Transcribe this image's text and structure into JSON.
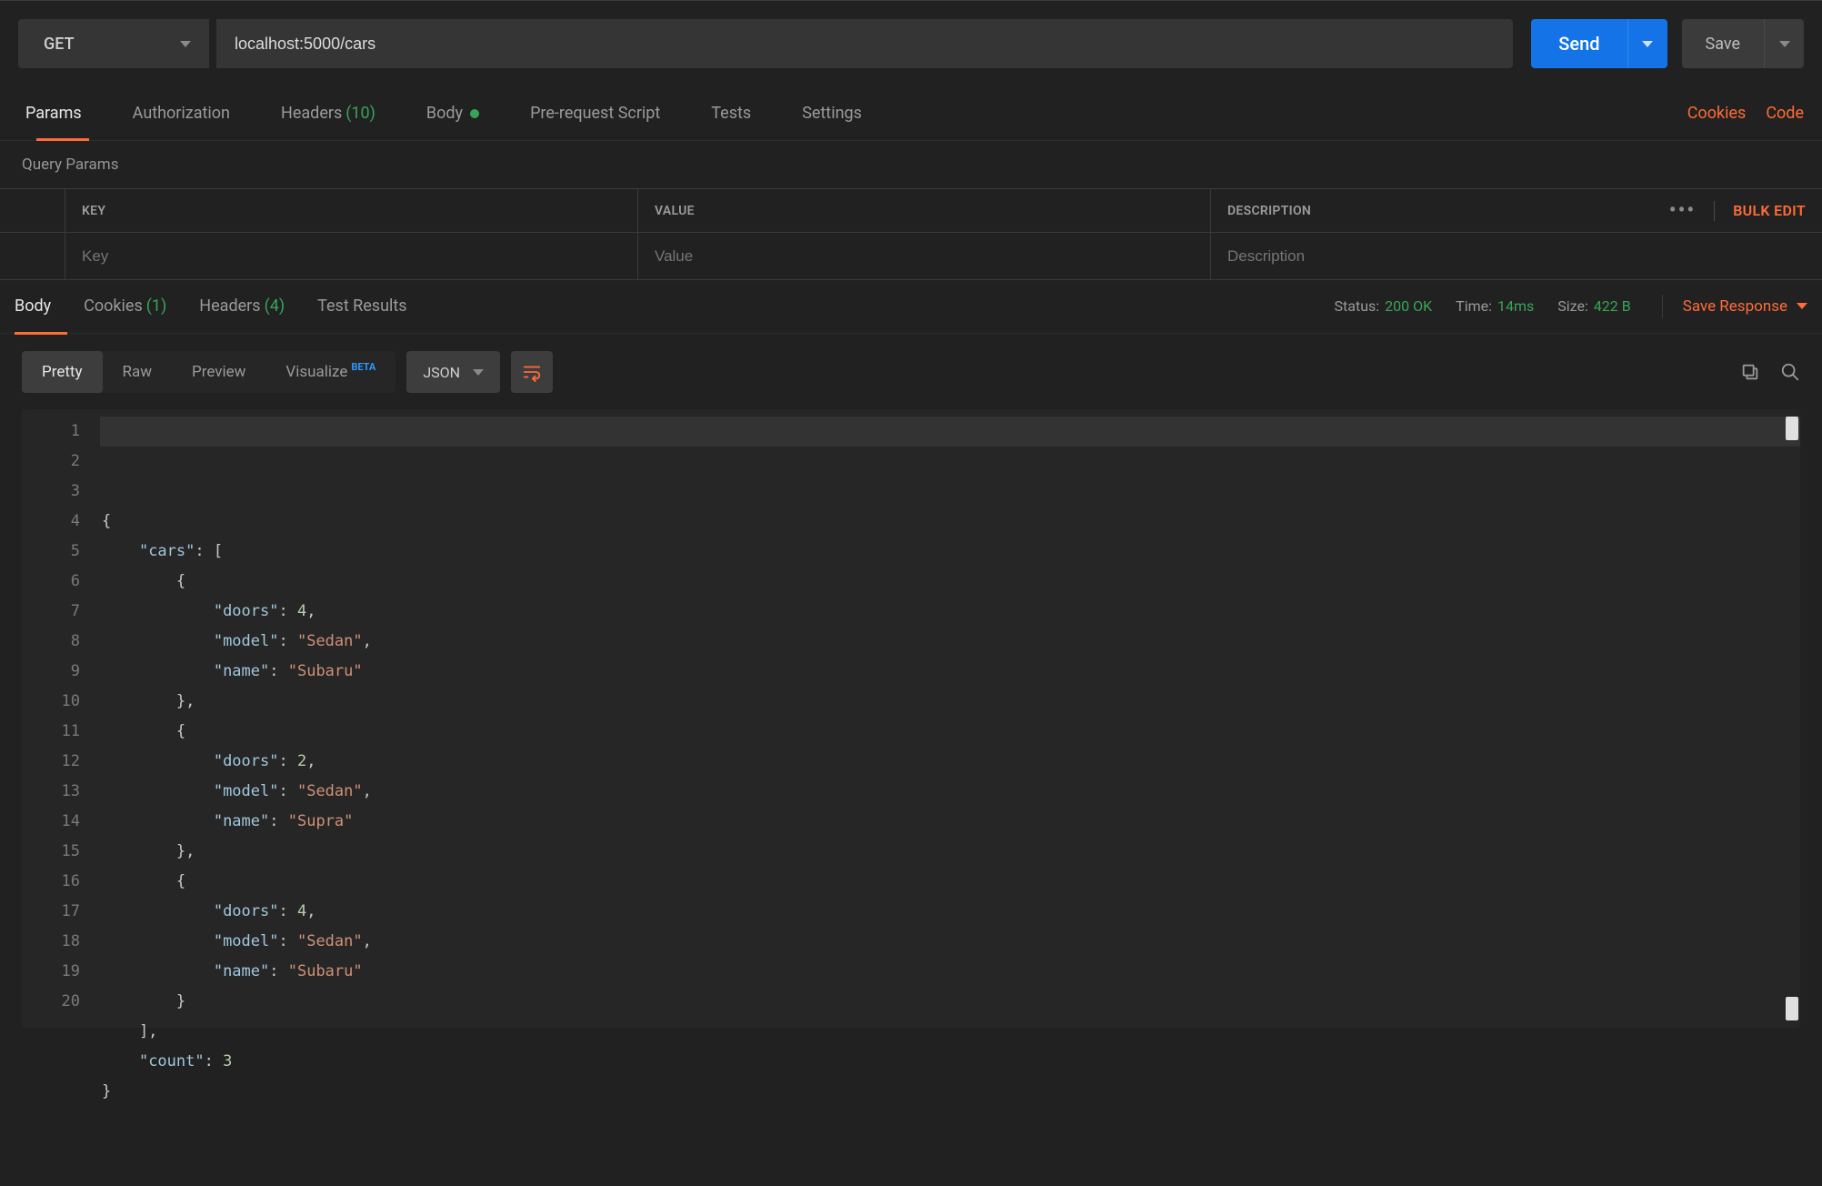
{
  "request": {
    "method": "GET",
    "url": "localhost:5000/cars",
    "send_label": "Send",
    "save_label": "Save"
  },
  "request_tabs": {
    "params": "Params",
    "auth": "Authorization",
    "headers": "Headers",
    "headers_count": "(10)",
    "body": "Body",
    "pre_req": "Pre-request Script",
    "tests": "Tests",
    "settings": "Settings",
    "cookies_link": "Cookies",
    "code_link": "Code"
  },
  "query_params": {
    "section_title": "Query Params",
    "header_key": "Key",
    "header_value": "Value",
    "header_description": "Description",
    "bulk_edit": "Bulk Edit",
    "placeholder_key": "Key",
    "placeholder_value": "Value",
    "placeholder_description": "Description"
  },
  "response_tabs": {
    "body": "Body",
    "cookies": "Cookies",
    "cookies_count": "(1)",
    "headers": "Headers",
    "headers_count": "(4)",
    "test_results": "Test Results"
  },
  "response_meta": {
    "status_label": "Status:",
    "status_value": "200 OK",
    "time_label": "Time:",
    "time_value": "14ms",
    "size_label": "Size:",
    "size_value": "422 B",
    "save_response": "Save Response"
  },
  "view_controls": {
    "pretty": "Pretty",
    "raw": "Raw",
    "preview": "Preview",
    "visualize": "Visualize",
    "beta": "BETA",
    "format": "JSON"
  },
  "code": {
    "line_numbers": [
      "1",
      "2",
      "3",
      "4",
      "5",
      "6",
      "7",
      "8",
      "9",
      "10",
      "11",
      "12",
      "13",
      "14",
      "15",
      "16",
      "17",
      "18",
      "19",
      "20"
    ],
    "lines": [
      [
        {
          "t": "{",
          "c": "punc"
        }
      ],
      [
        {
          "t": "    ",
          "c": "punc"
        },
        {
          "t": "\"cars\"",
          "c": "key"
        },
        {
          "t": ": [",
          "c": "punc"
        }
      ],
      [
        {
          "t": "        {",
          "c": "punc"
        }
      ],
      [
        {
          "t": "            ",
          "c": "punc"
        },
        {
          "t": "\"doors\"",
          "c": "key"
        },
        {
          "t": ": ",
          "c": "punc"
        },
        {
          "t": "4",
          "c": "num"
        },
        {
          "t": ",",
          "c": "punc"
        }
      ],
      [
        {
          "t": "            ",
          "c": "punc"
        },
        {
          "t": "\"model\"",
          "c": "key"
        },
        {
          "t": ": ",
          "c": "punc"
        },
        {
          "t": "\"Sedan\"",
          "c": "str"
        },
        {
          "t": ",",
          "c": "punc"
        }
      ],
      [
        {
          "t": "            ",
          "c": "punc"
        },
        {
          "t": "\"name\"",
          "c": "key"
        },
        {
          "t": ": ",
          "c": "punc"
        },
        {
          "t": "\"Subaru\"",
          "c": "str"
        }
      ],
      [
        {
          "t": "        },",
          "c": "punc"
        }
      ],
      [
        {
          "t": "        {",
          "c": "punc"
        }
      ],
      [
        {
          "t": "            ",
          "c": "punc"
        },
        {
          "t": "\"doors\"",
          "c": "key"
        },
        {
          "t": ": ",
          "c": "punc"
        },
        {
          "t": "2",
          "c": "num"
        },
        {
          "t": ",",
          "c": "punc"
        }
      ],
      [
        {
          "t": "            ",
          "c": "punc"
        },
        {
          "t": "\"model\"",
          "c": "key"
        },
        {
          "t": ": ",
          "c": "punc"
        },
        {
          "t": "\"Sedan\"",
          "c": "str"
        },
        {
          "t": ",",
          "c": "punc"
        }
      ],
      [
        {
          "t": "            ",
          "c": "punc"
        },
        {
          "t": "\"name\"",
          "c": "key"
        },
        {
          "t": ": ",
          "c": "punc"
        },
        {
          "t": "\"Supra\"",
          "c": "str"
        }
      ],
      [
        {
          "t": "        },",
          "c": "punc"
        }
      ],
      [
        {
          "t": "        {",
          "c": "punc"
        }
      ],
      [
        {
          "t": "            ",
          "c": "punc"
        },
        {
          "t": "\"doors\"",
          "c": "key"
        },
        {
          "t": ": ",
          "c": "punc"
        },
        {
          "t": "4",
          "c": "num"
        },
        {
          "t": ",",
          "c": "punc"
        }
      ],
      [
        {
          "t": "            ",
          "c": "punc"
        },
        {
          "t": "\"model\"",
          "c": "key"
        },
        {
          "t": ": ",
          "c": "punc"
        },
        {
          "t": "\"Sedan\"",
          "c": "str"
        },
        {
          "t": ",",
          "c": "punc"
        }
      ],
      [
        {
          "t": "            ",
          "c": "punc"
        },
        {
          "t": "\"name\"",
          "c": "key"
        },
        {
          "t": ": ",
          "c": "punc"
        },
        {
          "t": "\"Subaru\"",
          "c": "str"
        }
      ],
      [
        {
          "t": "        }",
          "c": "punc"
        }
      ],
      [
        {
          "t": "    ],",
          "c": "punc"
        }
      ],
      [
        {
          "t": "    ",
          "c": "punc"
        },
        {
          "t": "\"count\"",
          "c": "key"
        },
        {
          "t": ": ",
          "c": "punc"
        },
        {
          "t": "3",
          "c": "num"
        }
      ],
      [
        {
          "t": "}",
          "c": "punc"
        }
      ]
    ]
  }
}
